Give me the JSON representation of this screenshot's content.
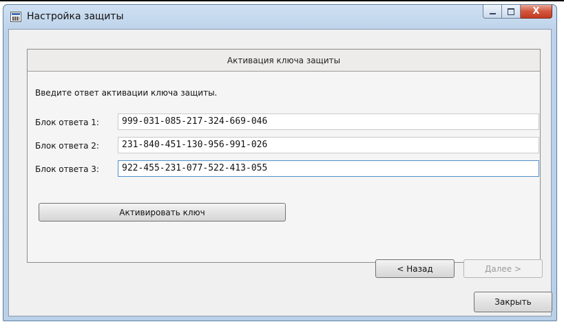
{
  "window": {
    "title": "Настройка защиты",
    "controls": {
      "close_glyph": "X"
    }
  },
  "panel": {
    "header": "Активация ключа защиты",
    "instruction": "Введите ответ активации ключа защиты.",
    "rows": [
      {
        "label": "Блок ответа 1:",
        "value": "999-031-085-217-324-669-046"
      },
      {
        "label": "Блок ответа 2:",
        "value": "231-840-451-130-956-991-026"
      },
      {
        "label": "Блок ответа 3:",
        "value": "922-455-231-077-522-413-055"
      }
    ],
    "activate_label": "Активировать ключ",
    "back_label": "< Назад",
    "next_label": "Далее >"
  },
  "footer": {
    "close_label": "Закрыть"
  }
}
